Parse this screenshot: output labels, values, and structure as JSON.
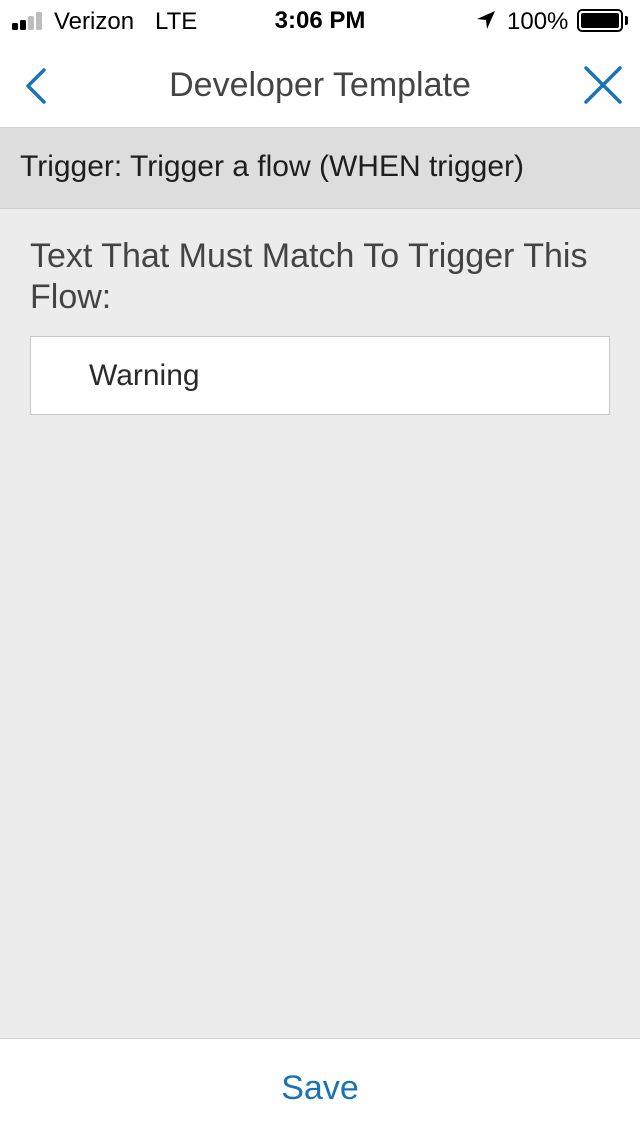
{
  "status_bar": {
    "carrier": "Verizon",
    "network": "LTE",
    "time": "3:06 PM",
    "battery_percent": "100%",
    "battery_level": 1.0,
    "signal_bars_filled": 2,
    "signal_bars_total": 4,
    "icons": [
      "signal-icon",
      "location-arrow-icon",
      "battery-icon"
    ]
  },
  "nav": {
    "title": "Developer Template",
    "back_icon": "chevron-left-icon",
    "close_icon": "close-icon",
    "accent_color": "#1a73b5"
  },
  "section": {
    "header": "Trigger: Trigger a flow (WHEN trigger)"
  },
  "form": {
    "label": "Text That Must Match To Trigger This Flow:",
    "input_value": "Warning"
  },
  "footer": {
    "save_label": "Save"
  }
}
